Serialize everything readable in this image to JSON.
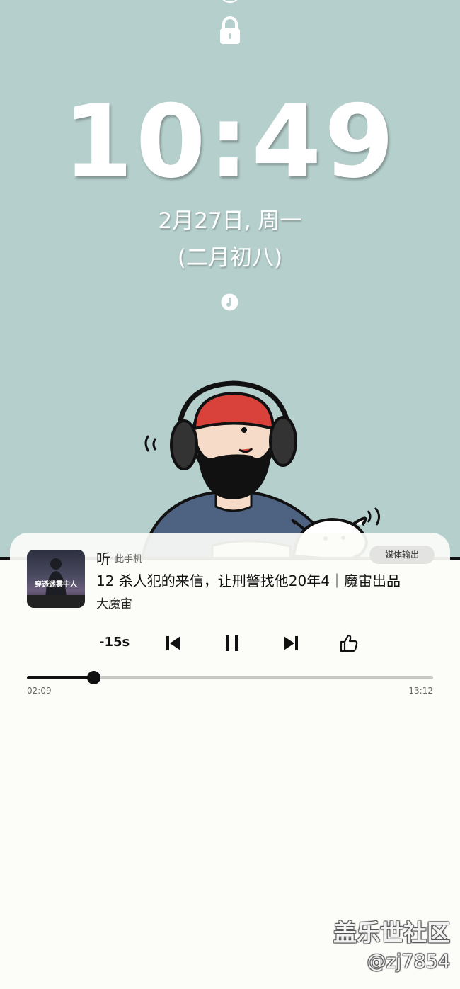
{
  "lockscreen": {
    "time": "10:49",
    "date": "2月27日, 周一",
    "lunar_date": "(二月初八)"
  },
  "media": {
    "album_art_text": "穿透迷雾中人",
    "app_name": "听",
    "device": "此手机",
    "output_button": "媒体输出",
    "track_title": "12 杀人犯的来信，让刑警找他20年4｜魔宙出品",
    "artist": "大魔宙",
    "rewind_label": "-15s",
    "elapsed": "02:09",
    "total": "13:12",
    "progress": 0.163
  },
  "watermark": {
    "forum": "盖乐世社区",
    "user": "@zj7854"
  },
  "colors": {
    "wallpaper": "#b5cfcc",
    "card": "#fcfcf9",
    "accent": "#111111"
  }
}
